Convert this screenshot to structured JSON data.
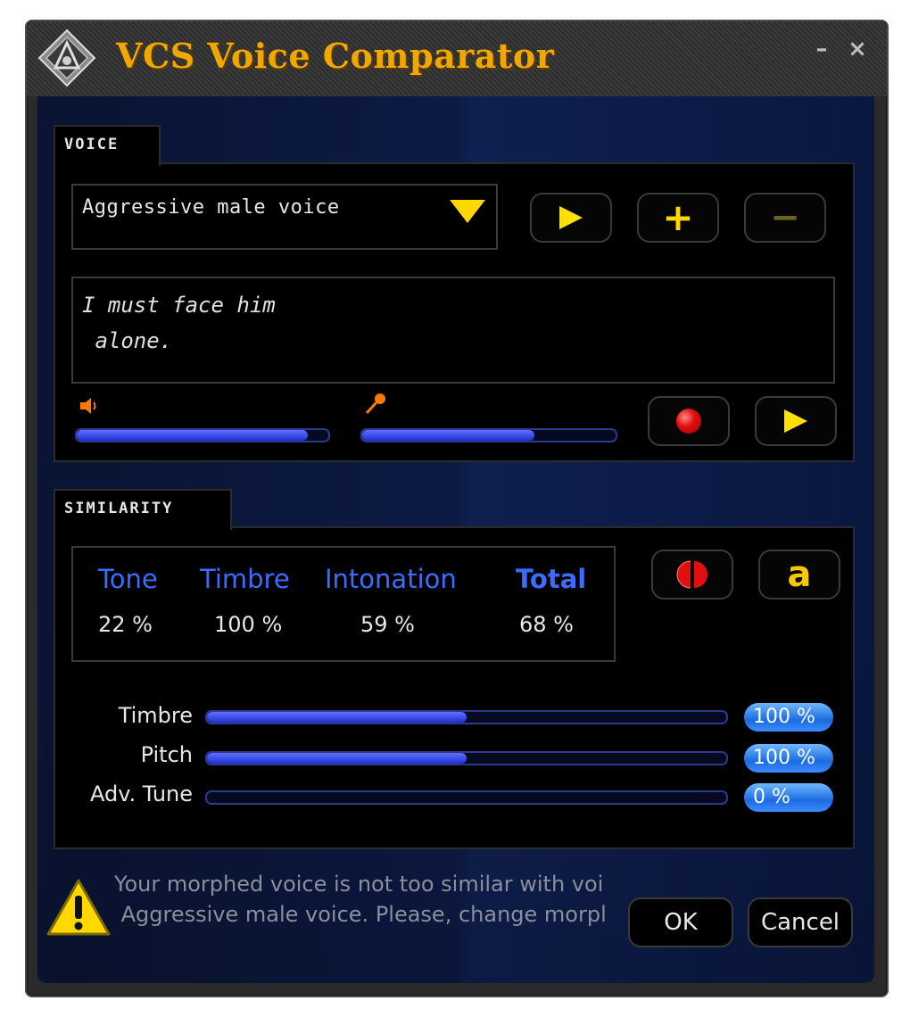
{
  "window": {
    "title": "VCS Voice Comparator",
    "minimize_label": "–",
    "close_label": "×"
  },
  "voice_section": {
    "tab_label": "VOICE",
    "selected_voice": "Aggressive male voice",
    "phrase_line1": "I must face him",
    "phrase_line2": " alone.",
    "playback_volume": 0.92,
    "mic_level": 0.68
  },
  "similarity_section": {
    "tab_label": "SIMILARITY",
    "headers": {
      "tone": "Tone",
      "timbre": "Timbre",
      "intonation": "Intonation",
      "total": "Total"
    },
    "values": {
      "tone": "22 %",
      "timbre": "100 %",
      "intonation": "59 %",
      "total": "68 %"
    },
    "sliders": [
      {
        "label": "Timbre",
        "value": "100 %",
        "level": 0.5
      },
      {
        "label": "Pitch",
        "value": "100 %",
        "level": 0.5
      },
      {
        "label": "Adv. Tune",
        "value": "0 %",
        "level": 0.0
      }
    ]
  },
  "message": {
    "line1": "Your morphed voice is not too similar with voi",
    "line2": " Aggressive male voice. Please, change morpl"
  },
  "buttons": {
    "ok": "OK",
    "cancel": "Cancel",
    "advanced_label": "a"
  },
  "colors": {
    "accent_blue": "#3b6cff",
    "title_gold": "#f0a800",
    "icon_yellow": "#ffd800"
  }
}
